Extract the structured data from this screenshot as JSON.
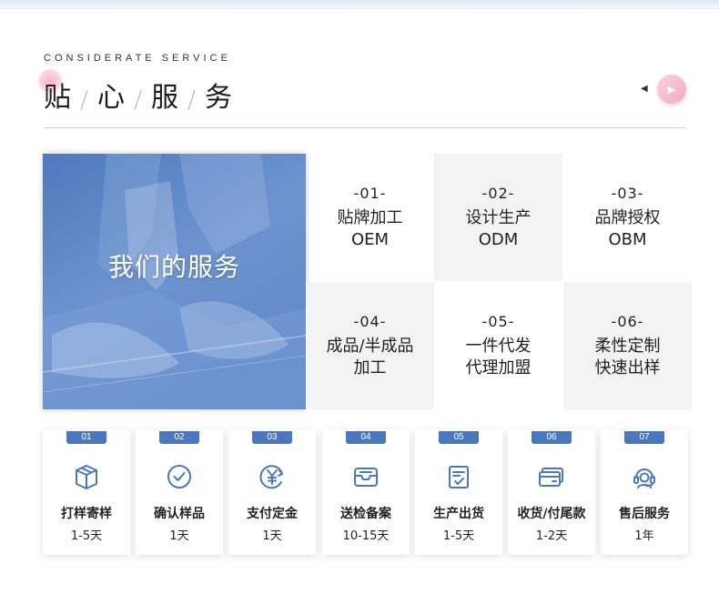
{
  "header": {
    "eyebrow": "CONSIDERATE SERVICE",
    "title_chars": [
      "贴",
      "心",
      "服",
      "务"
    ]
  },
  "hero": {
    "title": "我们的服务"
  },
  "services": [
    {
      "num": "-01-",
      "line1": "贴牌加工",
      "line2": "OEM"
    },
    {
      "num": "-02-",
      "line1": "设计生产",
      "line2": "ODM"
    },
    {
      "num": "-03-",
      "line1": "品牌授权",
      "line2": "OBM"
    },
    {
      "num": "-04-",
      "line1": "成品/半成品",
      "line2": "加工"
    },
    {
      "num": "-05-",
      "line1": "一件代发",
      "line2": "代理加盟"
    },
    {
      "num": "-06-",
      "line1": "柔性定制",
      "line2": "快速出样"
    }
  ],
  "steps": [
    {
      "badge": "01",
      "label": "打样寄样",
      "duration": "1-5天",
      "icon": "box-icon"
    },
    {
      "badge": "02",
      "label": "确认样品",
      "duration": "1天",
      "icon": "check-circle-icon"
    },
    {
      "badge": "03",
      "label": "支付定金",
      "duration": "1天",
      "icon": "yuan-refresh-icon"
    },
    {
      "badge": "04",
      "label": "送检备案",
      "duration": "10-15天",
      "icon": "inbox-tray-icon"
    },
    {
      "badge": "05",
      "label": "生产出货",
      "duration": "1-5天",
      "icon": "checklist-icon"
    },
    {
      "badge": "06",
      "label": "收货/付尾款",
      "duration": "1-2天",
      "icon": "credit-card-icon"
    },
    {
      "badge": "07",
      "label": "售后服务",
      "duration": "1年",
      "icon": "headset-agent-icon"
    }
  ],
  "colors": {
    "accent_blue": "#4b78bc",
    "pink": "#f3a9c1",
    "cell_shade": "#f3f3f3"
  }
}
